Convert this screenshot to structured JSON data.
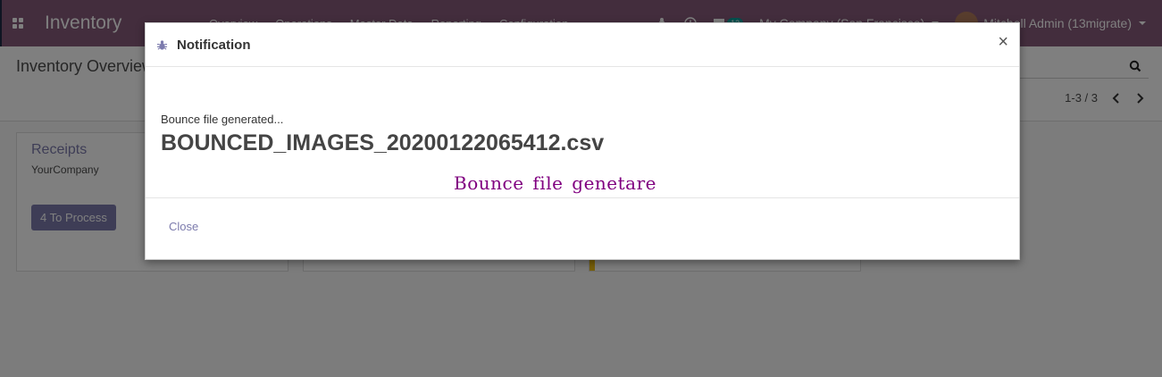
{
  "navbar": {
    "app_name": "Inventory",
    "menu": [
      "Overview",
      "Operations",
      "Master Data",
      "Reporting",
      "Configuration"
    ],
    "message_count": "13",
    "company": "My Company (San Francisco)",
    "user": "Mitchell Admin (13migrate)"
  },
  "control_panel": {
    "breadcrumb": "Inventory Overview",
    "pager": "1-3 / 3"
  },
  "dashboard": {
    "cards": [
      {
        "title": "Receipts",
        "company": "YourCompany",
        "button": "4 To Process"
      }
    ]
  },
  "dialog": {
    "title": "Notification",
    "message": "Bounce file generated...",
    "filename": "BOUNCED_IMAGES_20200122065412.csv",
    "annotation": "Bounce file genetare",
    "close_button": "Close",
    "close_icon": "×"
  },
  "colors": {
    "brand": "#875a7b",
    "accent": "#7c7bad",
    "annotation": "#800080"
  }
}
